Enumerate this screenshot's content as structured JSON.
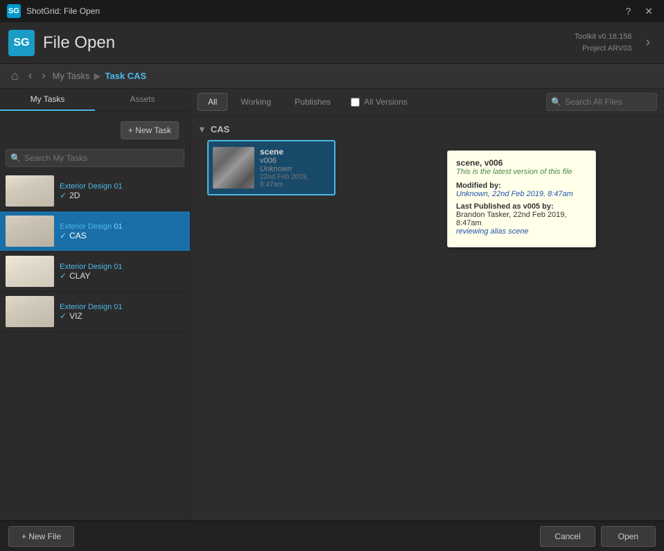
{
  "window": {
    "title": "ShotGrid: File Open",
    "help_btn": "?",
    "close_btn": "✕"
  },
  "header": {
    "logo": "SG",
    "title": "File Open",
    "toolkit_label": "Toolkit v0.18.158",
    "project_label": "Project ARV03"
  },
  "breadcrumb": {
    "my_tasks": "My Tasks",
    "separator": "▶",
    "task_label": "Task",
    "task_name": "CAS"
  },
  "left_panel": {
    "tabs": [
      {
        "id": "my-tasks",
        "label": "My Tasks",
        "active": true
      },
      {
        "id": "assets",
        "label": "Assets",
        "active": false
      }
    ],
    "new_task_btn": "+ New Task",
    "search_placeholder": "Search My Tasks",
    "tasks": [
      {
        "project": "Exterior Design",
        "project_num": "01",
        "name": "2D",
        "active": false,
        "thumb_class": "car-sketch-1"
      },
      {
        "project": "Exterior Design",
        "project_num": "01",
        "name": "CAS",
        "active": true,
        "thumb_class": "car-sketch-2"
      },
      {
        "project": "Exterior Design",
        "project_num": "01",
        "name": "CLAY",
        "active": false,
        "thumb_class": "car-sketch-3"
      },
      {
        "project": "Exterior Design",
        "project_num": "01",
        "name": "VIZ",
        "active": false,
        "thumb_class": "car-sketch-4"
      }
    ]
  },
  "right_panel": {
    "tabs": [
      {
        "id": "all",
        "label": "All",
        "active": true
      },
      {
        "id": "working",
        "label": "Working",
        "active": false
      },
      {
        "id": "publishes",
        "label": "Publishes",
        "active": false
      }
    ],
    "all_versions_label": "All Versions",
    "search_placeholder": "Search All Files",
    "folder_name": "CAS",
    "files": [
      {
        "name": "scene",
        "version": "v006",
        "author": "Unknown",
        "date": "22nd Feb 2019, 8:47am",
        "selected": true
      }
    ]
  },
  "tooltip": {
    "title": "scene, v006",
    "latest_label": "This is the latest version of this file",
    "modified_label": "Modified by:",
    "modified_value": "Unknown, 22nd Feb 2019, 8:47am",
    "published_label": "Last Published as v005 by:",
    "published_value": "Brandon Tasker, 22nd Feb 2019, 8:47am",
    "published_comment": "reviewing alias scene"
  },
  "bottom_bar": {
    "new_file_btn": "+ New File",
    "cancel_btn": "Cancel",
    "open_btn": "Open"
  }
}
